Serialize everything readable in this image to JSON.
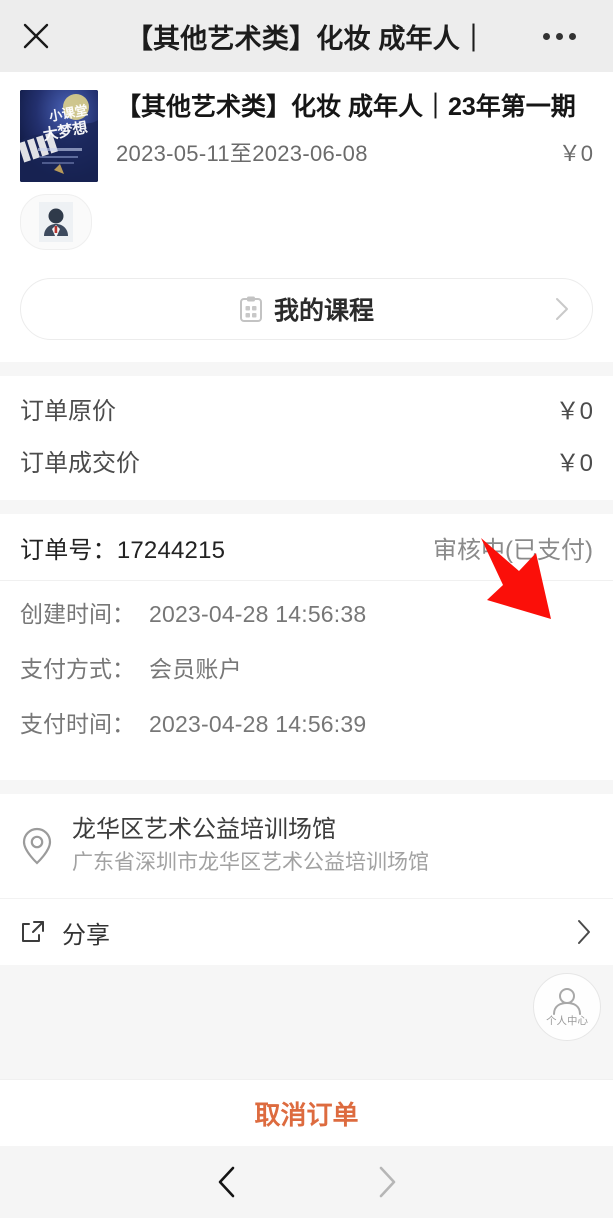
{
  "navbar": {
    "close_icon": "close-icon",
    "title": "【其他艺术类】化妆 成年人｜",
    "more_icon": "more-icon"
  },
  "course": {
    "title": "【其他艺术类】化妆 成年人｜23年第一期",
    "date_range": "2023-05-11至2023-06-08",
    "price": "￥0",
    "thumbnail_text_top": "小课堂",
    "thumbnail_text_bottom": "大梦想",
    "avatar_name": "student-avatar"
  },
  "my_course": {
    "label": "我的课程",
    "icon": "clipboard-icon",
    "chevron": "chevron-right-icon"
  },
  "prices": [
    {
      "label": "订单原价",
      "value": "￥0"
    },
    {
      "label": "订单成交价",
      "value": "￥0"
    }
  ],
  "order": {
    "number_label": "订单号：",
    "number": "17244215",
    "status": "审核中(已支付)",
    "status_color": "#8a8a8a",
    "details": [
      {
        "label": "创建时间：",
        "value": "2023-04-28 14:56:38"
      },
      {
        "label": "支付方式：",
        "value": "会员账户"
      },
      {
        "label": "支付时间：",
        "value": "2023-04-28 14:56:39"
      }
    ]
  },
  "venue": {
    "icon": "location-pin-icon",
    "name": "龙华区艺术公益培训场馆",
    "address": "广东省深圳市龙华区艺术公益培训场馆"
  },
  "share": {
    "icon": "external-link-icon",
    "label": "分享",
    "chevron": "chevron-right-icon"
  },
  "fab": {
    "icon": "user-icon",
    "label": "个人中心"
  },
  "action": {
    "label": "取消订单",
    "color": "#dd6b3f"
  },
  "browser_nav": {
    "back_icon": "chevron-left-icon",
    "forward_icon": "chevron-right-icon"
  },
  "annotation": {
    "arrow_color": "#fb0f09",
    "points_to": "审核中(已支付)"
  }
}
